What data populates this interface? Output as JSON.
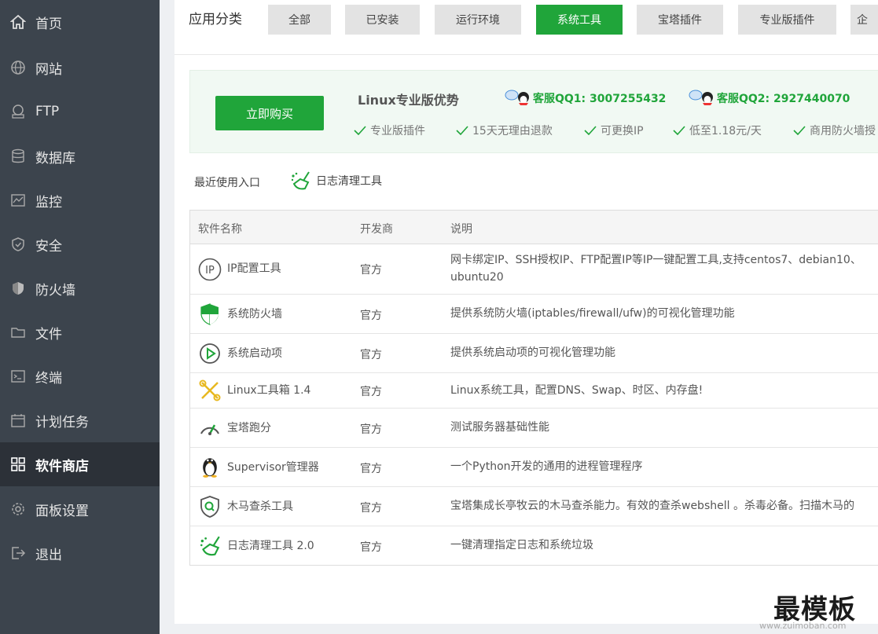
{
  "sidebar": {
    "items": [
      {
        "label": "首页",
        "icon": "home-icon",
        "active": false
      },
      {
        "label": "网站",
        "icon": "globe-icon"
      },
      {
        "label": "FTP",
        "icon": "ftp-icon"
      },
      {
        "label": "数据库",
        "icon": "database-icon"
      },
      {
        "label": "监控",
        "icon": "monitor-icon"
      },
      {
        "label": "安全",
        "icon": "shield-icon"
      },
      {
        "label": "防火墙",
        "icon": "firewall-icon"
      },
      {
        "label": "文件",
        "icon": "folder-icon"
      },
      {
        "label": "终端",
        "icon": "terminal-icon"
      },
      {
        "label": "计划任务",
        "icon": "calendar-icon"
      },
      {
        "label": "软件商店",
        "icon": "grid-icon",
        "active": true
      },
      {
        "label": "面板设置",
        "icon": "gear-icon"
      },
      {
        "label": "退出",
        "icon": "logout-icon"
      }
    ]
  },
  "categories": {
    "label": "应用分类",
    "items": [
      "全部",
      "已安装",
      "运行环境",
      "系统工具",
      "宝塔插件",
      "专业版插件",
      "企"
    ],
    "active": "系统工具"
  },
  "promo": {
    "buy_label": "立即购买",
    "title": "Linux专业版优势",
    "qq1": "客服QQ1: 3007255432",
    "qq2": "客服QQ2: 2927440070",
    "features": [
      "专业版插件",
      "15天无理由退款",
      "可更换IP",
      "低至1.18元/天",
      "商用防火墙授"
    ]
  },
  "recent": {
    "label": "最近使用入口",
    "item": "日志清理工具"
  },
  "table": {
    "headers": [
      "软件名称",
      "开发商",
      "说明"
    ],
    "rows": [
      {
        "name": "IP配置工具",
        "dev": "官方",
        "desc": "网卡绑定IP、SSH授权IP、FTP配置IP等IP一键配置工具,支持centos7、debian10、ubuntu20",
        "icon": "ip-icon"
      },
      {
        "name": "系统防火墙",
        "dev": "官方",
        "desc": "提供系统防火墙(iptables/firewall/ufw)的可视化管理功能",
        "icon": "shield-icon"
      },
      {
        "name": "系统启动项",
        "dev": "官方",
        "desc": "提供系统启动项的可视化管理功能",
        "icon": "play-icon"
      },
      {
        "name": "Linux工具箱 1.4",
        "dev": "官方",
        "desc": "Linux系统工具，配置DNS、Swap、时区、内存盘!",
        "icon": "tools-icon"
      },
      {
        "name": "宝塔跑分",
        "dev": "官方",
        "desc": "测试服务器基础性能",
        "icon": "gauge-icon"
      },
      {
        "name": "Supervisor管理器",
        "dev": "官方",
        "desc": "一个Python开发的通用的进程管理程序",
        "icon": "penguin-icon"
      },
      {
        "name": "木马查杀工具",
        "dev": "官方",
        "desc": "宝塔集成长亭牧云的木马查杀能力。有效的查杀webshell 。杀毒必备。扫描木马的",
        "icon": "virus-scan-icon"
      },
      {
        "name": "日志清理工具 2.0",
        "dev": "官方",
        "desc": "一键清理指定日志和系统垃圾",
        "icon": "broom-icon"
      }
    ]
  },
  "watermark": {
    "text": "最模板",
    "url": "www.zuimoban.com"
  },
  "colors": {
    "accent": "#20a53a",
    "sidebar_bg": "#3c444d",
    "sidebar_active": "#2c3138"
  }
}
